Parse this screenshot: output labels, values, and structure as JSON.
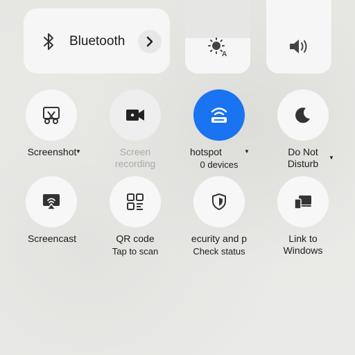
{
  "bluetooth": {
    "label": "Bluetooth"
  },
  "brightness": {
    "level": 0.2
  },
  "volume": {
    "level": 0.0
  },
  "tiles": {
    "screenshot": {
      "label": "Screenshot"
    },
    "screen_recording": {
      "label_line1": "Screen",
      "label_line2": "recording"
    },
    "hotspot": {
      "label": "hotspot",
      "sub": "0 devices"
    },
    "dnd": {
      "label_line1": "Do Not",
      "label_line2": "Disturb"
    },
    "screencast": {
      "label": "Screencast"
    },
    "qr": {
      "label": "QR code",
      "sub": "Tap to scan"
    },
    "security": {
      "label": "ecurity and p",
      "sub": "Check status"
    },
    "link_windows": {
      "label_line1": "Link to",
      "label_line2": "Windows"
    }
  },
  "colors": {
    "accent": "#1a73f0",
    "tile": "#f7f7f7",
    "text": "#1c1c1c",
    "disabled_text": "#a9a9a9"
  }
}
